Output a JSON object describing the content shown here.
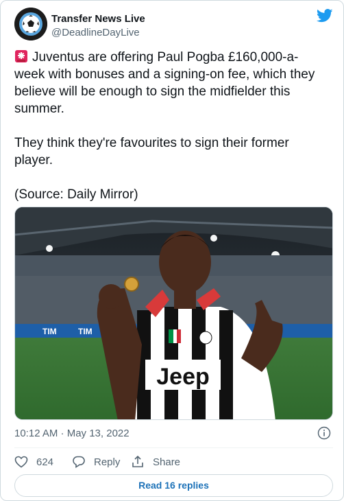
{
  "account": {
    "name": "Transfer News Live",
    "handle": "@DeadlineDayLive"
  },
  "tweet": {
    "paragraph1": "Juventus are offering Paul Pogba £160,000-a-week with bonuses and a signing-on fee, which they believe will be enough to sign the midfielder this summer.",
    "paragraph2": "They think they're favourites to sign their former player.",
    "paragraph3": "(Source: Daily Mirror)"
  },
  "photo": {
    "shirt_sponsor": "Jeep",
    "board_text": "TIM"
  },
  "meta": {
    "timestamp": "10:12 AM · May 13, 2022"
  },
  "actions": {
    "like_count": "624",
    "reply_label": "Reply",
    "share_label": "Share"
  },
  "read_replies_label": "Read 16 replies",
  "colors": {
    "twitter_blue": "#1d9bf0",
    "text_primary": "#0f1419",
    "text_secondary": "#536471",
    "link_blue": "#1d72b8"
  },
  "icons": [
    "soccer-ball-avatar",
    "twitter-bird-icon",
    "siren-emoji-icon",
    "info-icon",
    "heart-icon",
    "reply-bubble-icon",
    "share-icon"
  ]
}
